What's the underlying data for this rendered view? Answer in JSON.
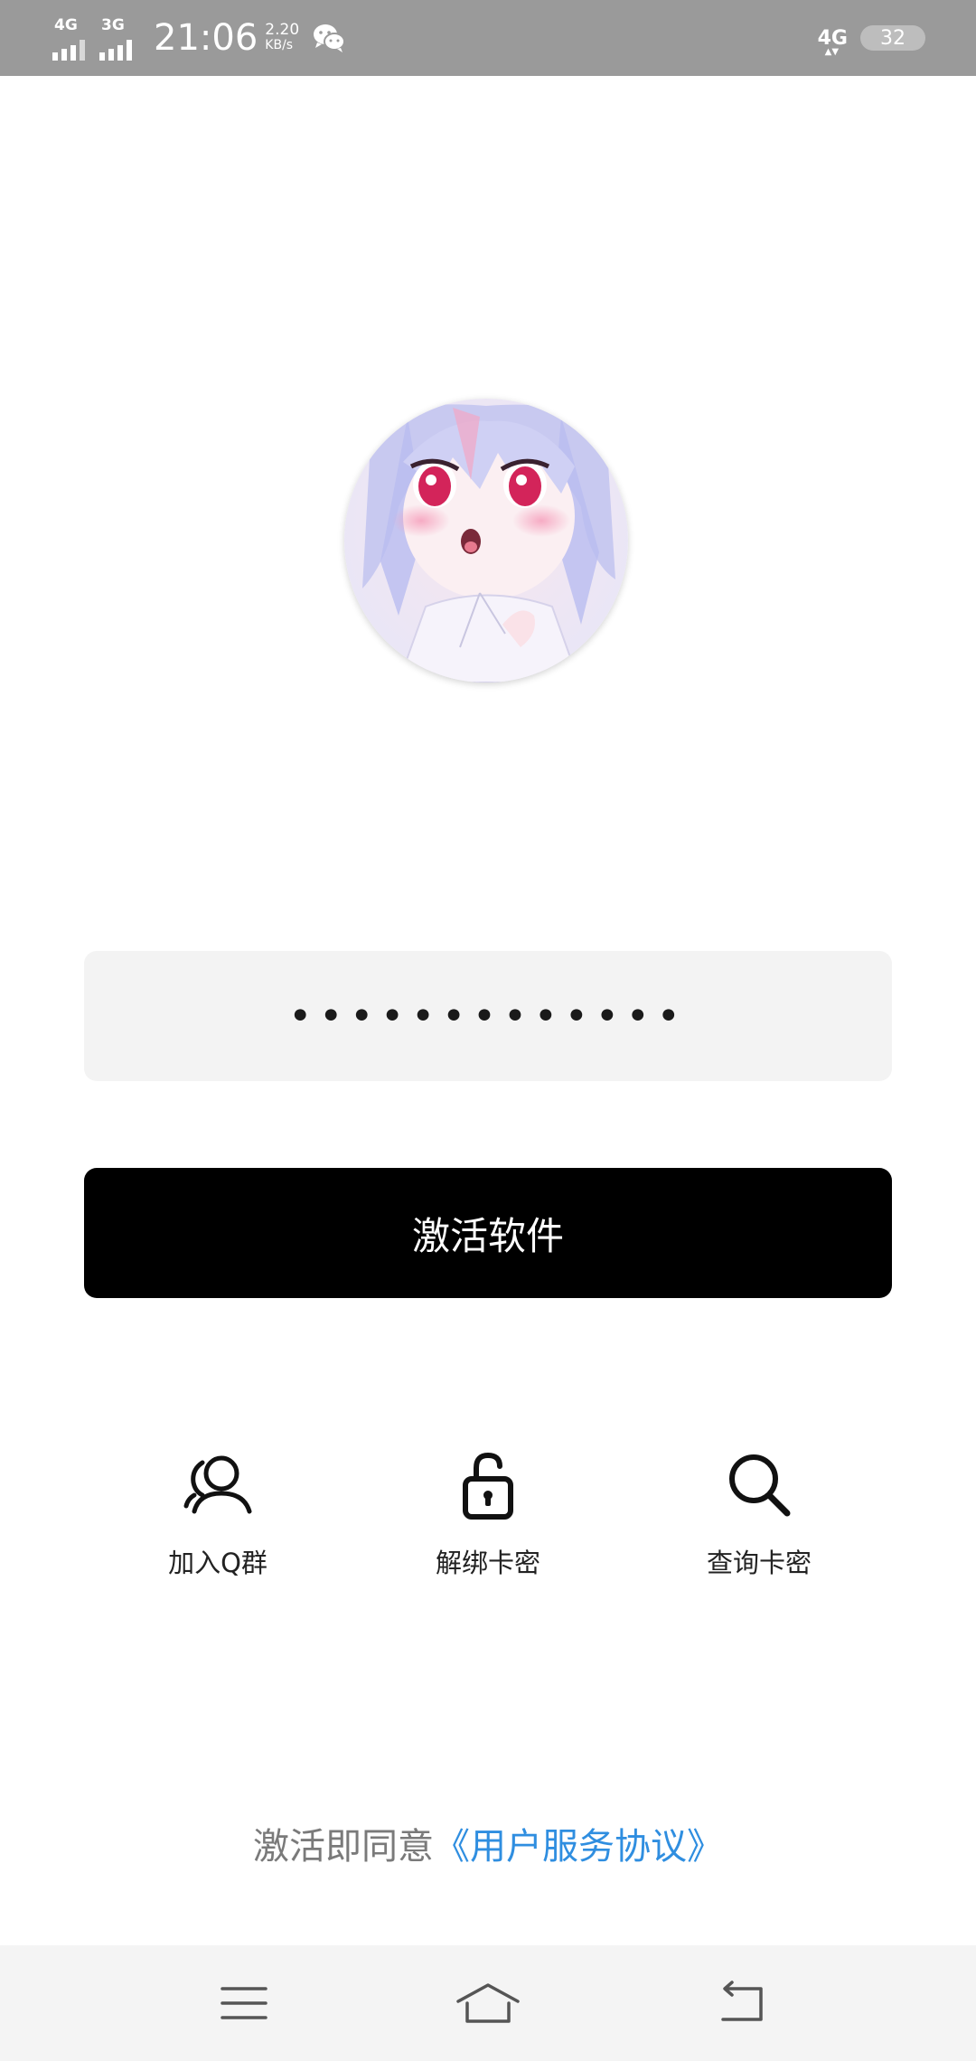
{
  "status_bar": {
    "signal1_label": "4G",
    "signal2_label": "3G",
    "time": "21:06",
    "speed_value": "2.20",
    "speed_unit": "KB/s",
    "network_label": "4G",
    "battery_level": "32"
  },
  "login": {
    "password_value": "•••••••••••••",
    "activate_button_label": "激活软件"
  },
  "actions": [
    {
      "label": "加入Q群",
      "icon": "user-group-icon"
    },
    {
      "label": "解绑卡密",
      "icon": "unlock-icon"
    },
    {
      "label": "查询卡密",
      "icon": "search-icon"
    }
  ],
  "agreement": {
    "prefix": "激活即同意",
    "link": "《用户服务协议》"
  },
  "colors": {
    "status_bar_bg": "#9a9a9a",
    "button_bg": "#000000",
    "input_bg": "#f3f3f3",
    "link": "#2f8ee0",
    "nav_bg": "#f4f4f4"
  }
}
